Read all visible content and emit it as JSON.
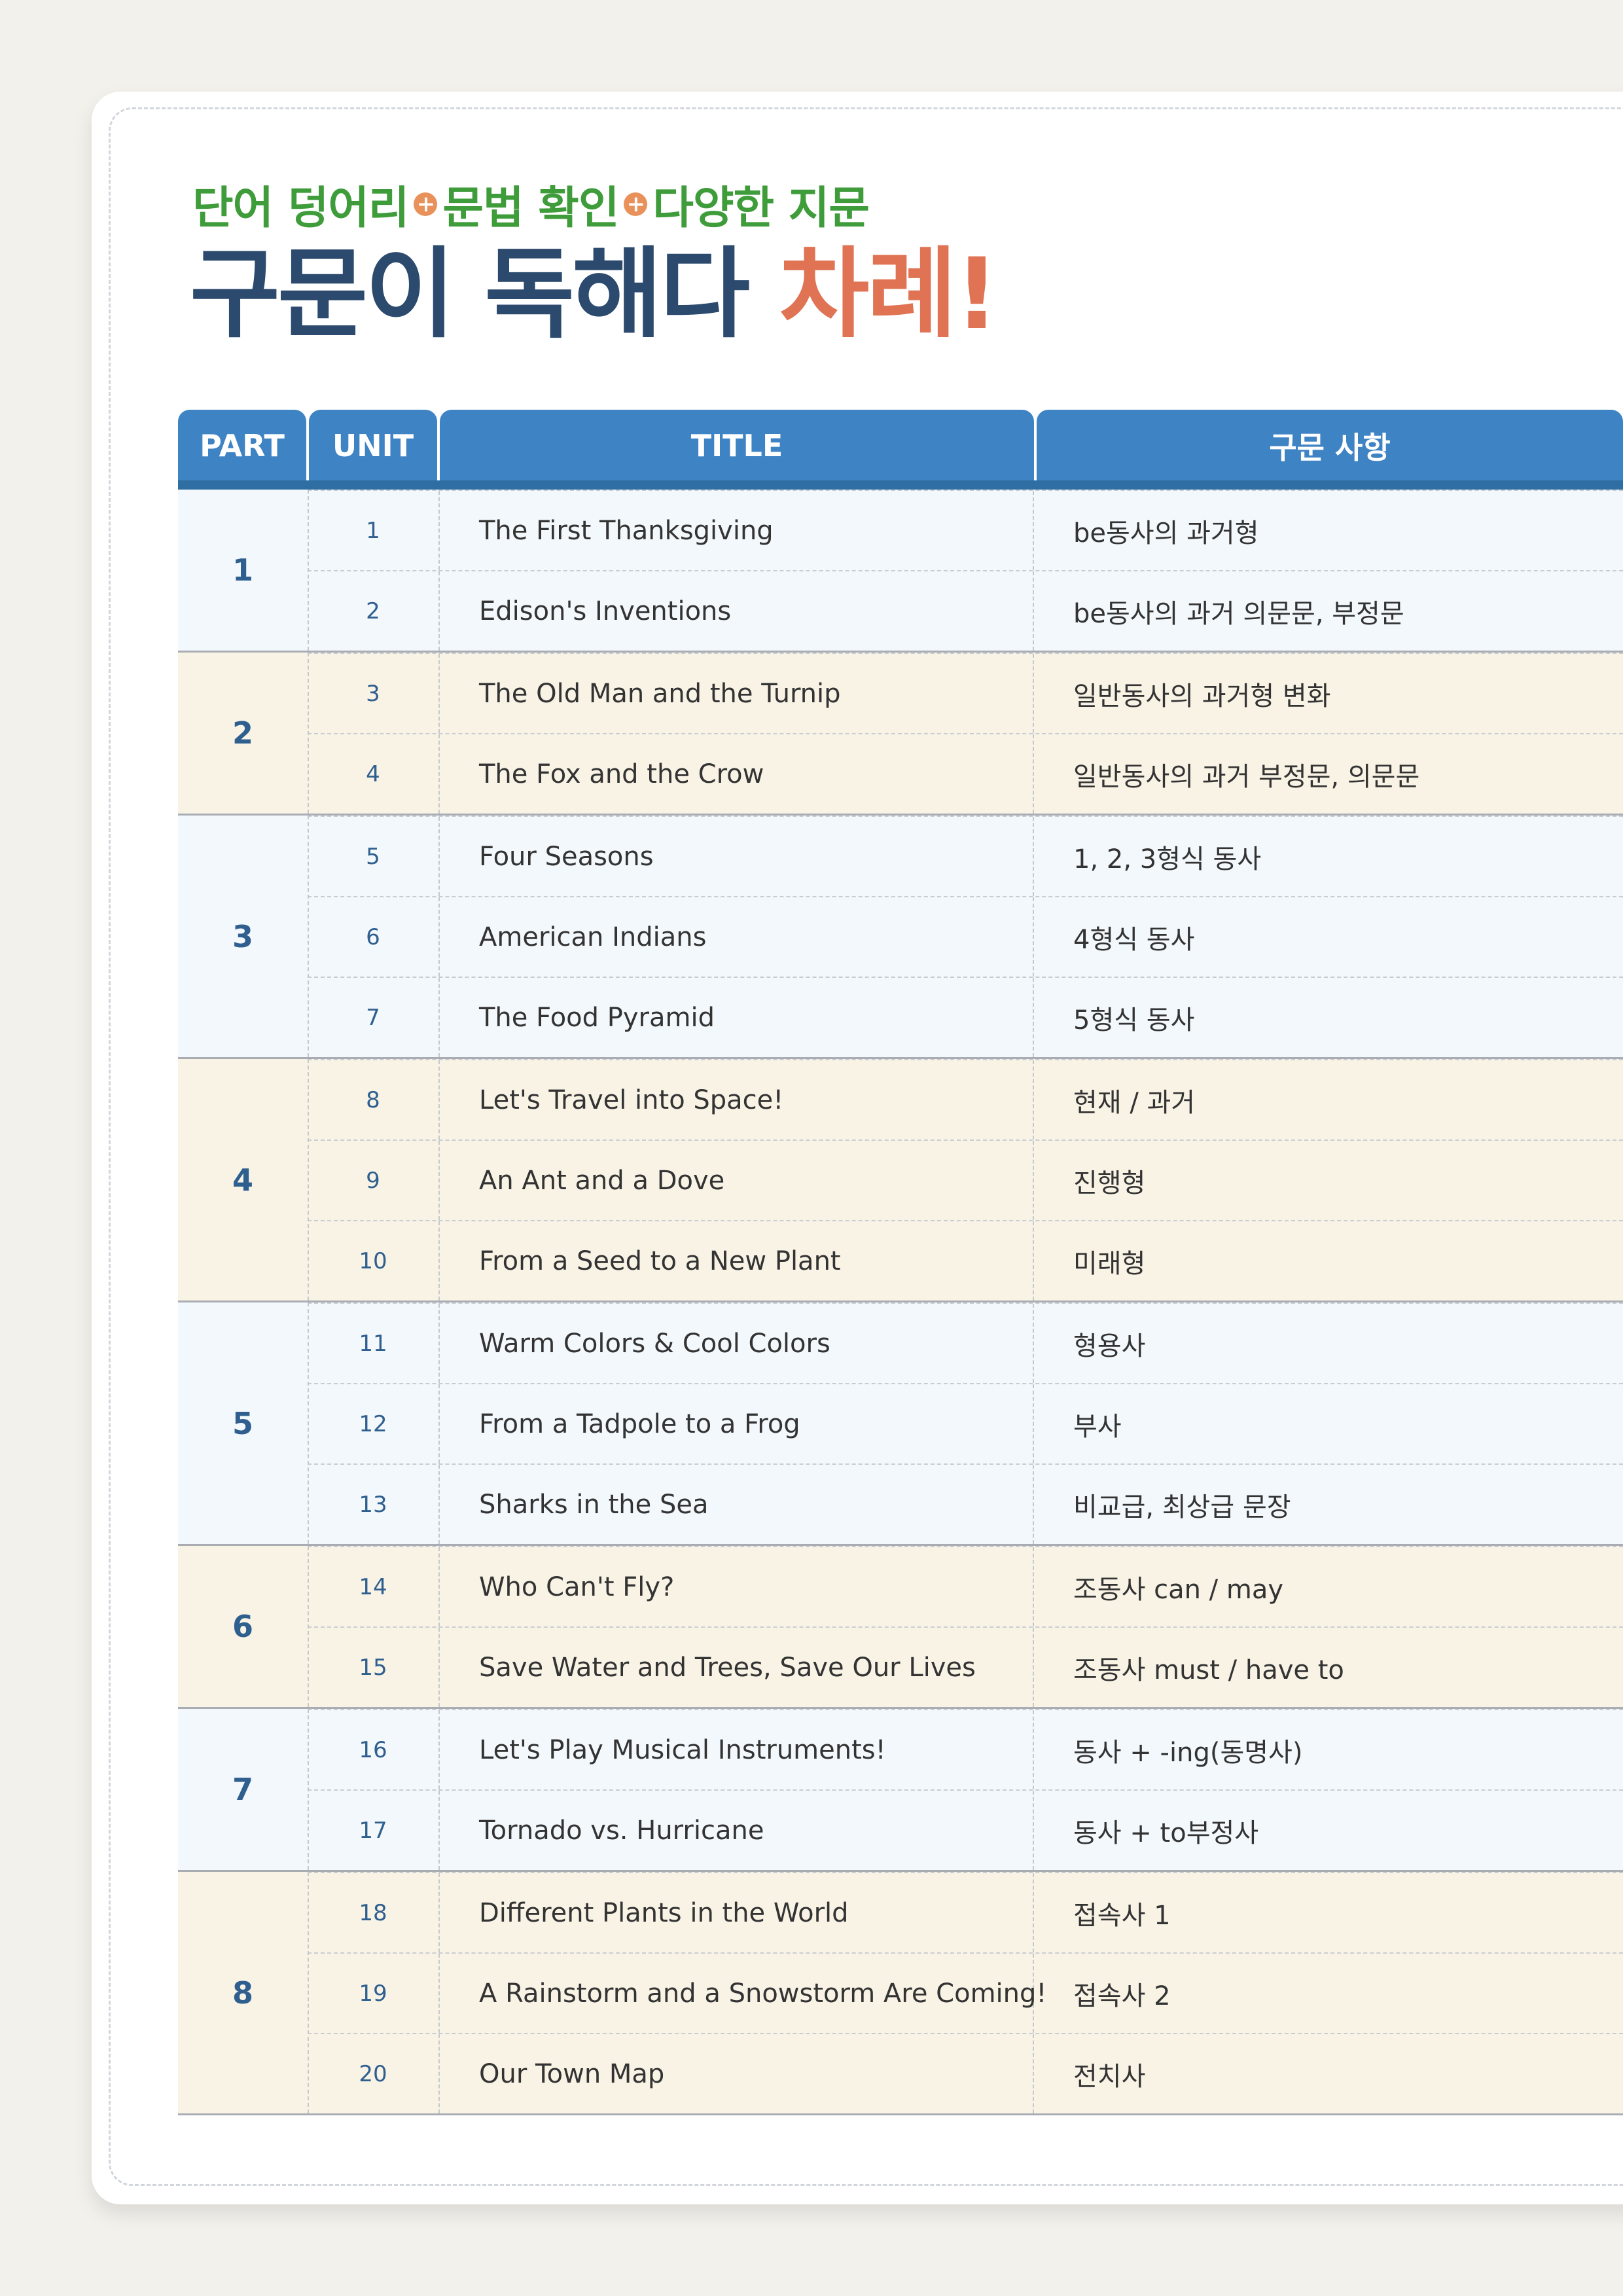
{
  "header": {
    "subtitle_parts": [
      "단어 덩어리",
      "문법 확인",
      "다양한 지문"
    ],
    "plus_symbol": "+",
    "title_main": "구문이 독해다",
    "title_accent": "차례!"
  },
  "table": {
    "columns": [
      "PART",
      "UNIT",
      "TITLE",
      "구문 사항"
    ],
    "parts": [
      {
        "part": "1",
        "units": [
          {
            "unit": "1",
            "title": "The First Thanksgiving",
            "grammar": "be동사의 과거형"
          },
          {
            "unit": "2",
            "title": "Edison's Inventions",
            "grammar": "be동사의 과거 의문문, 부정문"
          }
        ]
      },
      {
        "part": "2",
        "units": [
          {
            "unit": "3",
            "title": "The Old Man and the Turnip",
            "grammar": "일반동사의 과거형 변화"
          },
          {
            "unit": "4",
            "title": "The Fox and the Crow",
            "grammar": "일반동사의 과거 부정문, 의문문"
          }
        ]
      },
      {
        "part": "3",
        "units": [
          {
            "unit": "5",
            "title": "Four Seasons",
            "grammar": "1, 2, 3형식 동사"
          },
          {
            "unit": "6",
            "title": "American Indians",
            "grammar": "4형식 동사"
          },
          {
            "unit": "7",
            "title": "The Food Pyramid",
            "grammar": "5형식 동사"
          }
        ]
      },
      {
        "part": "4",
        "units": [
          {
            "unit": "8",
            "title": "Let's Travel into Space!",
            "grammar": "현재 / 과거"
          },
          {
            "unit": "9",
            "title": "An Ant and a Dove",
            "grammar": "진행형"
          },
          {
            "unit": "10",
            "title": "From a Seed to a New Plant",
            "grammar": "미래형"
          }
        ]
      },
      {
        "part": "5",
        "units": [
          {
            "unit": "11",
            "title": "Warm Colors & Cool Colors",
            "grammar": "형용사"
          },
          {
            "unit": "12",
            "title": "From a Tadpole to a Frog",
            "grammar": "부사"
          },
          {
            "unit": "13",
            "title": "Sharks in the Sea",
            "grammar": "비교급, 최상급 문장"
          }
        ]
      },
      {
        "part": "6",
        "units": [
          {
            "unit": "14",
            "title": "Who Can't Fly?",
            "grammar": "조동사 can / may"
          },
          {
            "unit": "15",
            "title": "Save Water and Trees, Save Our Lives",
            "grammar": "조동사 must / have to"
          }
        ]
      },
      {
        "part": "7",
        "units": [
          {
            "unit": "16",
            "title": "Let's Play Musical Instruments!",
            "grammar": "동사 + -ing(동명사)"
          },
          {
            "unit": "17",
            "title": "Tornado vs. Hurricane",
            "grammar": "동사 + to부정사"
          }
        ]
      },
      {
        "part": "8",
        "units": [
          {
            "unit": "18",
            "title": "Different Plants in the World",
            "grammar": "접속사 1"
          },
          {
            "unit": "19",
            "title": "A Rainstorm and a Snowstorm Are Coming!",
            "grammar": "접속사 2"
          },
          {
            "unit": "20",
            "title": "Our Town Map",
            "grammar": "전치사"
          }
        ]
      }
    ]
  },
  "colors": {
    "header_blue": "#3e83c3",
    "header_bar": "#2f6ea3",
    "row_blue": "#f3f8fc",
    "row_cream": "#f9f3e6",
    "subtitle_green": "#3f9c3a",
    "title_navy": "#2c4a6e",
    "title_accent": "#e07354",
    "plus_orange": "#e9915a"
  }
}
